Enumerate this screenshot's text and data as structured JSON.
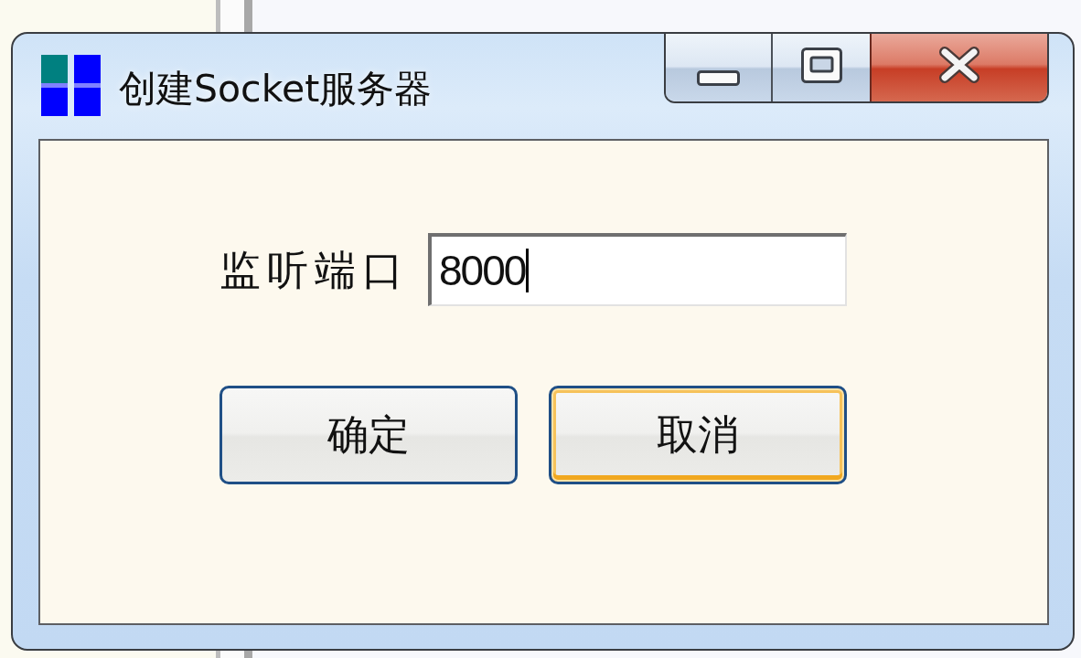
{
  "window": {
    "title": "创建Socket服务器"
  },
  "form": {
    "label": "监听端口",
    "value": "8000",
    "focused": true
  },
  "buttons": [
    {
      "label": "确定",
      "highlighted": false
    },
    {
      "label": "取消",
      "highlighted": true
    }
  ]
}
